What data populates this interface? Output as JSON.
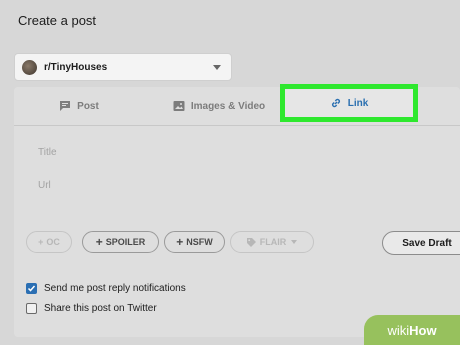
{
  "header": {
    "title": "Create a post"
  },
  "community": {
    "name": "r/TinyHouses"
  },
  "tabs": [
    {
      "label": "Post"
    },
    {
      "label": "Images & Video"
    },
    {
      "label": "Link"
    }
  ],
  "form": {
    "title_placeholder": "Title",
    "url_placeholder": "Url"
  },
  "tags": {
    "oc": "OC",
    "spoiler": "SPOILER",
    "nsfw": "NSFW",
    "flair": "FLAIR"
  },
  "actions": {
    "save_draft": "Save Draft"
  },
  "options": [
    {
      "label": "Send me post reply notifications",
      "checked": true
    },
    {
      "label": "Share this post on Twitter",
      "checked": false
    }
  ],
  "watermark": {
    "wiki": "wiki",
    "how": "How"
  },
  "colors": {
    "link_accent": "#2a6fb0",
    "highlight": "#2ee82e",
    "checkbox": "#2b6fb3"
  }
}
